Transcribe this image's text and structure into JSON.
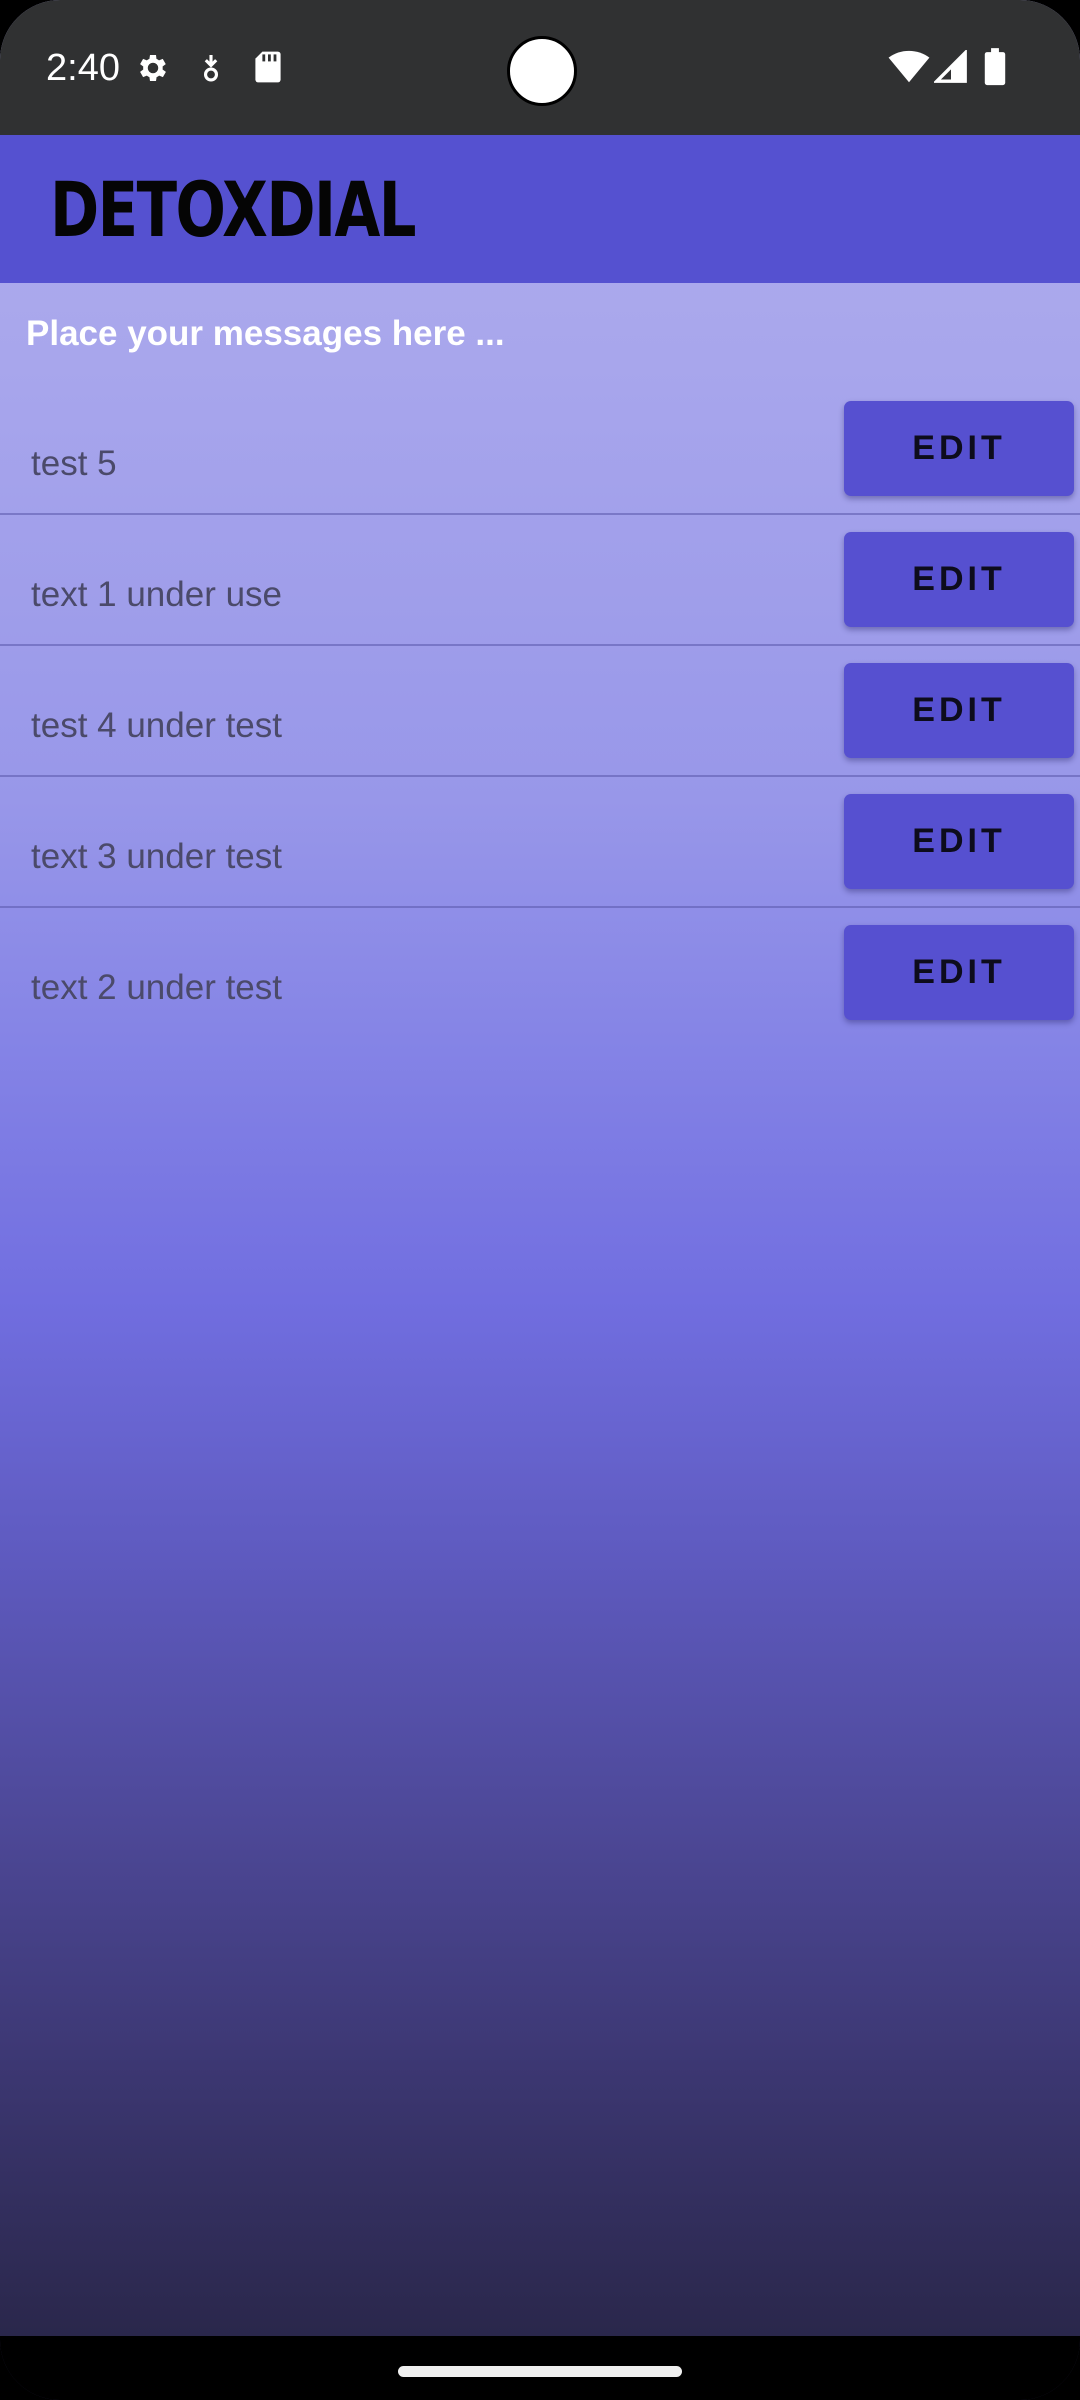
{
  "status_bar": {
    "time": "2:40",
    "left_icons": [
      "gear-icon",
      "download-icon",
      "sd-card-icon"
    ],
    "right_icons": [
      "wifi-icon",
      "cell-signal-icon",
      "battery-icon"
    ]
  },
  "app_bar": {
    "title": "DETOXDIAL",
    "color": "#5551d0"
  },
  "hint": "Place your messages here ...",
  "messages": [
    {
      "text": "test 5",
      "button": "EDIT"
    },
    {
      "text": "text 1 under use",
      "button": "EDIT"
    },
    {
      "text": "test 4 under test",
      "button": "EDIT"
    },
    {
      "text": "text 3 under test",
      "button": "EDIT"
    },
    {
      "text": "text 2 under test",
      "button": "EDIT"
    }
  ],
  "colors": {
    "accent": "#5551d0",
    "status_bar": "#303132",
    "gradient_top": "#b3b1ef",
    "gradient_bottom": "#2a274b"
  }
}
